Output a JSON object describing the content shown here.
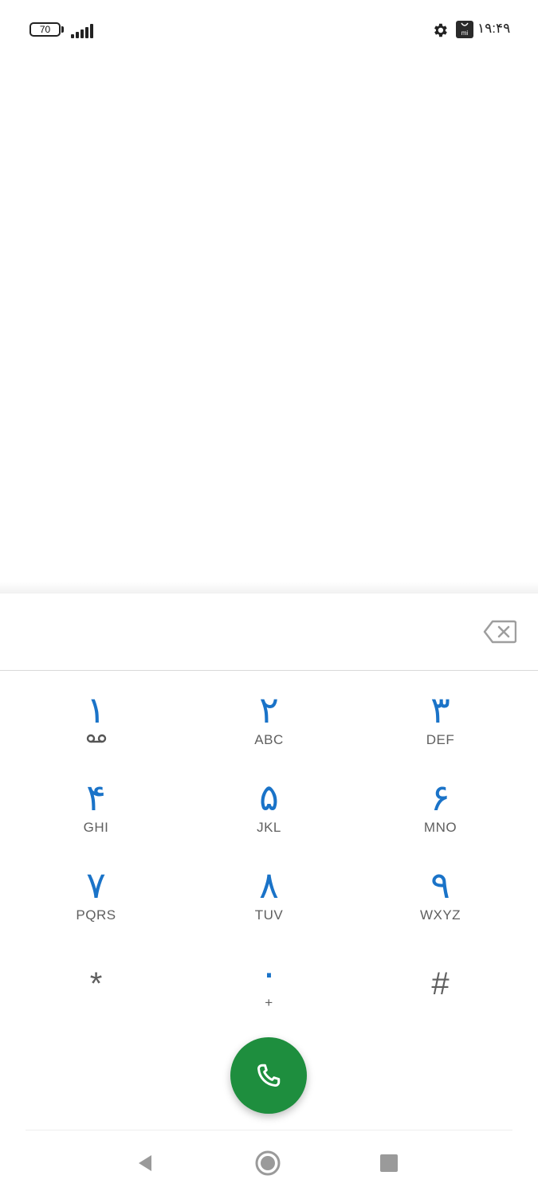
{
  "status_bar": {
    "battery_level": "70",
    "clock": "۱۹:۴۹",
    "icons": [
      "battery-icon",
      "signal-icon",
      "gear-icon",
      "mi-store-icon"
    ],
    "mi_label": "mi"
  },
  "dialer": {
    "entered_number": "",
    "keys": [
      {
        "digit": "۱",
        "letters": "",
        "icon": "voicemail-icon"
      },
      {
        "digit": "۲",
        "letters": "ABC"
      },
      {
        "digit": "۳",
        "letters": "DEF"
      },
      {
        "digit": "۴",
        "letters": "GHI"
      },
      {
        "digit": "۵",
        "letters": "JKL"
      },
      {
        "digit": "۶",
        "letters": "MNO"
      },
      {
        "digit": "۷",
        "letters": "PQRS"
      },
      {
        "digit": "۸",
        "letters": "TUV"
      },
      {
        "digit": "۹",
        "letters": "WXYZ"
      },
      {
        "digit": "*",
        "letters": ""
      },
      {
        "digit": "۰",
        "letters": "+"
      },
      {
        "digit": "#",
        "letters": ""
      }
    ],
    "call_button_icon": "phone-icon",
    "backspace_icon": "backspace-icon"
  },
  "colors": {
    "digit": "#1a73c8",
    "letters": "#5f5f5f",
    "call_button": "#1e8e3e"
  },
  "nav_bar": {
    "icons": [
      "back-icon",
      "home-icon",
      "recents-icon"
    ]
  }
}
